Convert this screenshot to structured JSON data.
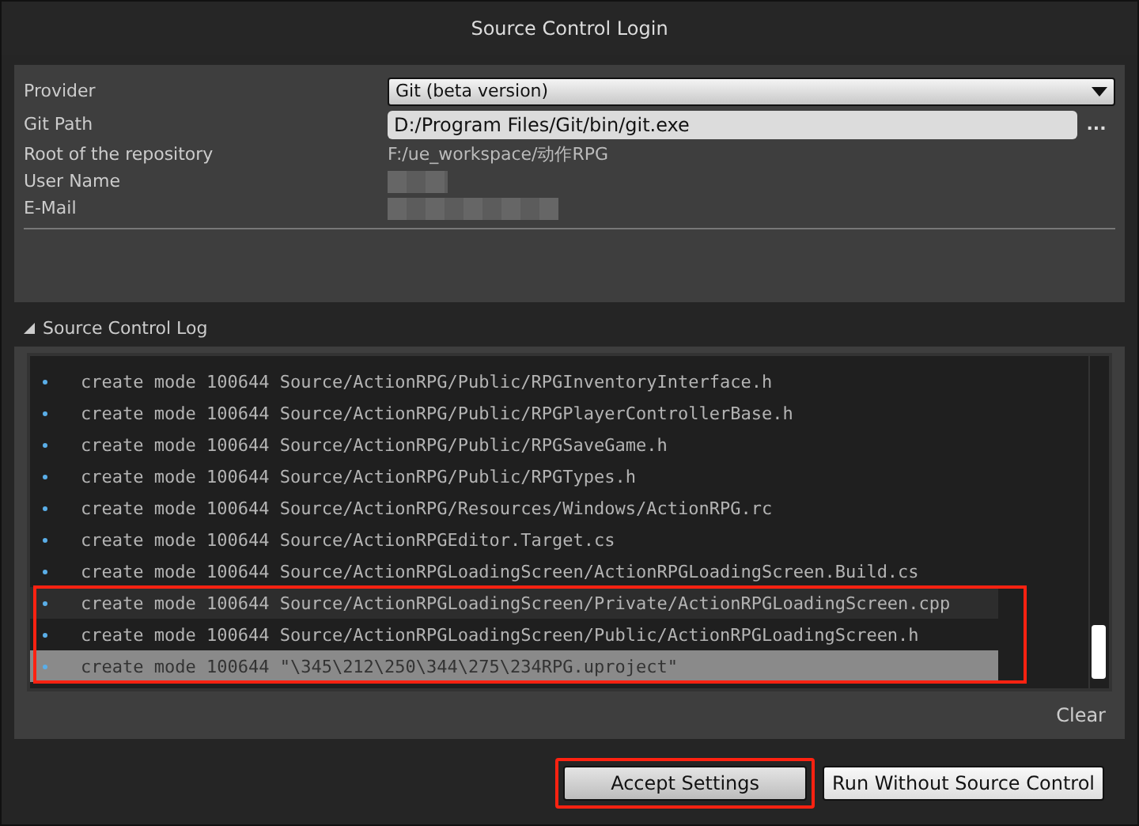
{
  "window": {
    "title": "Source Control Login"
  },
  "settings": {
    "provider": {
      "label": "Provider",
      "value": "Git  (beta version)"
    },
    "git_path": {
      "label": "Git Path",
      "value": "D:/Program Files/Git/bin/git.exe",
      "browse": "..."
    },
    "repository_root": {
      "label": "Root of the repository",
      "value": "F:/ue_workspace/动作RPG"
    },
    "user_name": {
      "label": "User Name"
    },
    "email": {
      "label": "E-Mail"
    }
  },
  "log": {
    "title": "Source Control Log",
    "expanded": true,
    "annotated": true,
    "rows": [
      {
        "text": "create mode 100644 Source/ActionRPG/Public/RPGInventoryInterface.h",
        "selected": false,
        "hovered": false
      },
      {
        "text": "create mode 100644 Source/ActionRPG/Public/RPGPlayerControllerBase.h",
        "selected": false,
        "hovered": false
      },
      {
        "text": "create mode 100644 Source/ActionRPG/Public/RPGSaveGame.h",
        "selected": false,
        "hovered": false
      },
      {
        "text": "create mode 100644 Source/ActionRPG/Public/RPGTypes.h",
        "selected": false,
        "hovered": false
      },
      {
        "text": "create mode 100644 Source/ActionRPG/Resources/Windows/ActionRPG.rc",
        "selected": false,
        "hovered": false
      },
      {
        "text": "create mode 100644 Source/ActionRPGEditor.Target.cs",
        "selected": false,
        "hovered": false
      },
      {
        "text": "create mode 100644 Source/ActionRPGLoadingScreen/ActionRPGLoadingScreen.Build.cs",
        "selected": false,
        "hovered": false
      },
      {
        "text": "create mode 100644 Source/ActionRPGLoadingScreen/Private/ActionRPGLoadingScreen.cpp",
        "selected": false,
        "hovered": true
      },
      {
        "text": "create mode 100644 Source/ActionRPGLoadingScreen/Public/ActionRPGLoadingScreen.h",
        "selected": false,
        "hovered": false
      },
      {
        "text": "create mode 100644 \"\\345\\212\\250\\344\\275\\234RPG.uproject\"",
        "selected": true,
        "hovered": false
      }
    ],
    "clear": "Clear"
  },
  "buttons": [
    {
      "label": "Accept Settings",
      "kind": "primary",
      "annotated": true
    },
    {
      "label": "Run Without Source Control",
      "kind": "secondary",
      "annotated": false
    }
  ]
}
